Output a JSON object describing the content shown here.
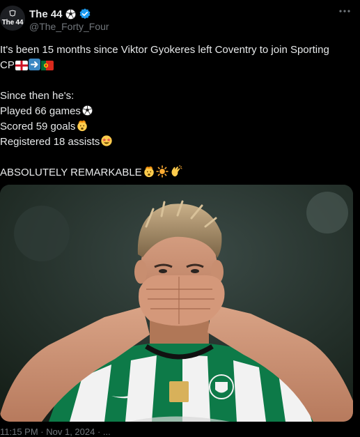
{
  "author": {
    "avatar_text": "The 44",
    "name": "The 44",
    "handle": "@The_Forty_Four",
    "verified_icon": "verified-badge-icon",
    "name_emoji": "soccer-ball-icon"
  },
  "more_icon": "more-options-icon",
  "tweet": {
    "line1": "It's been 15 months since Viktor Gyokeres left Coventry to join Sporting",
    "line2": "CP",
    "line3": "Since then he's:",
    "line4": "Played 66 games",
    "line5": "Scored 59 goals",
    "line6": "Registered 18 assists",
    "line7": "ABSOLUTELY REMARKABLE"
  },
  "media": {
    "description_icon": "player-photo",
    "kit_colors": {
      "green": "#0d7a48",
      "white": "#f2f2f2"
    }
  },
  "footer": {
    "timestamp": "11:15 PM · Nov 1, 2024 · ..."
  },
  "colors": {
    "background": "#000000",
    "text": "#e7e9ea",
    "muted": "#71767b",
    "verified": "#1d9bf0"
  }
}
